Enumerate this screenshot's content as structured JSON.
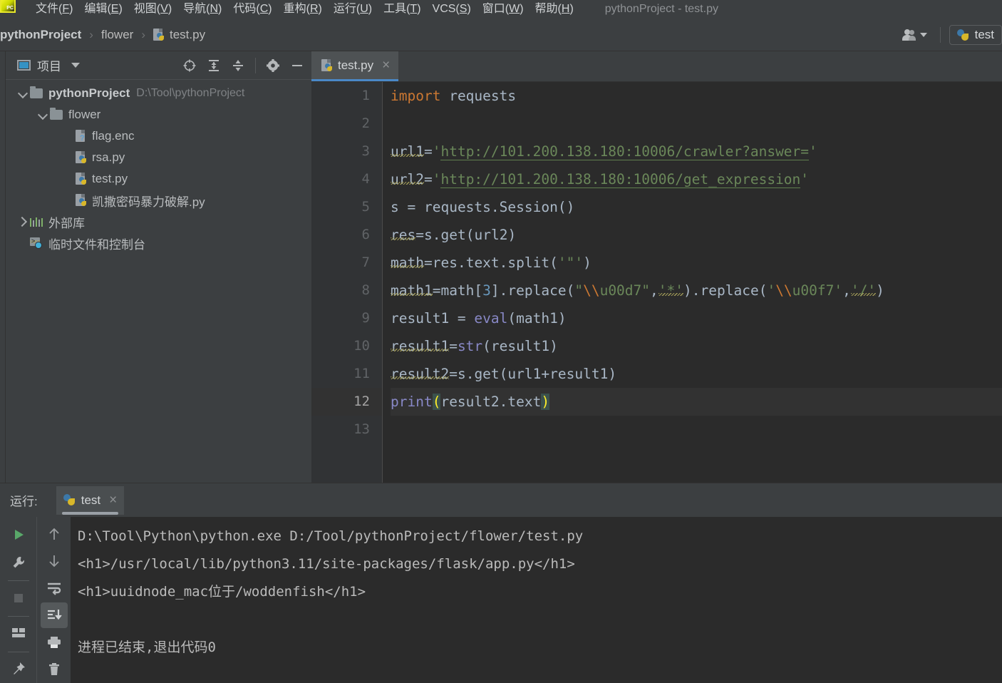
{
  "window": {
    "title": "pythonProject - test.py",
    "logo_text": "PC"
  },
  "menubar": {
    "items": [
      {
        "label": "文件(F)",
        "mnemonic": "F"
      },
      {
        "label": "编辑(E)",
        "mnemonic": "E"
      },
      {
        "label": "视图(V)",
        "mnemonic": "V"
      },
      {
        "label": "导航(N)",
        "mnemonic": "N"
      },
      {
        "label": "代码(C)",
        "mnemonic": "C"
      },
      {
        "label": "重构(R)",
        "mnemonic": "R"
      },
      {
        "label": "运行(U)",
        "mnemonic": "U"
      },
      {
        "label": "工具(T)",
        "mnemonic": "T"
      },
      {
        "label": "VCS(S)",
        "mnemonic": "S"
      },
      {
        "label": "窗口(W)",
        "mnemonic": "W"
      },
      {
        "label": "帮助(H)",
        "mnemonic": "H"
      }
    ]
  },
  "navbar": {
    "crumbs": [
      "pythonProject",
      "flower",
      "test.py"
    ],
    "separator": "›",
    "run_config": "test"
  },
  "project": {
    "title": "项目",
    "toolbar_icons": [
      "locate-icon",
      "expand-all-icon",
      "collapse-all-icon",
      "gear-icon",
      "hide-icon"
    ],
    "tree": [
      {
        "label": "pythonProject",
        "path": "D:\\Tool\\pythonProject",
        "icon": "folder-icon",
        "indent": 0,
        "expanded": true,
        "bold": true
      },
      {
        "label": "flower",
        "path": "",
        "icon": "folder-icon",
        "indent": 1,
        "expanded": true,
        "bold": false
      },
      {
        "label": "flag.enc",
        "path": "",
        "icon": "unknown-file-icon",
        "indent": 2,
        "expanded": null,
        "bold": false
      },
      {
        "label": "rsa.py",
        "path": "",
        "icon": "python-file-icon",
        "indent": 2,
        "expanded": null,
        "bold": false
      },
      {
        "label": "test.py",
        "path": "",
        "icon": "python-file-icon",
        "indent": 2,
        "expanded": null,
        "bold": false
      },
      {
        "label": "凯撒密码暴力破解.py",
        "path": "",
        "icon": "python-file-icon",
        "indent": 2,
        "expanded": null,
        "bold": false
      },
      {
        "label": "外部库",
        "path": "",
        "icon": "library-icon",
        "indent": 0,
        "expanded": false,
        "bold": false
      },
      {
        "label": "临时文件和控制台",
        "path": "",
        "icon": "scratches-icon",
        "indent": 0,
        "expanded": null,
        "bold": false
      }
    ]
  },
  "editor": {
    "tab": {
      "label": "test.py",
      "close": "×"
    },
    "line_numbers": [
      1,
      2,
      3,
      4,
      5,
      6,
      7,
      8,
      9,
      10,
      11,
      12,
      13
    ],
    "current_line": 12,
    "lines": [
      "import requests",
      "",
      "url1='http://101.200.138.180:10006/crawler?answer='",
      "url2='http://101.200.138.180:10006/get_expression'",
      "s = requests.Session()",
      "res=s.get(url2)",
      "math=res.text.split('\"')",
      "math1=math[3].replace(\"\\\\u00d7\",'*').replace('\\\\u00f7','/')",
      "result1 = eval(math1)",
      "result1=str(result1)",
      "result2=s.get(url1+result1)",
      "print(result2.text)",
      ""
    ]
  },
  "run": {
    "label": "运行:",
    "tab": {
      "label": "test",
      "close": "×"
    },
    "toolbar_left": [
      "rerun-icon",
      "settings-icon",
      "stop-icon",
      "layout-icon",
      "pin-icon"
    ],
    "toolbar_right": [
      "up-icon",
      "down-icon",
      "soft-wrap-icon",
      "scroll-to-end-icon",
      "print-icon",
      "trash-icon"
    ],
    "console": [
      "D:\\Tool\\Python\\python.exe D:/Tool/pythonProject/flower/test.py",
      "<h1>/usr/local/lib/python3.11/site-packages/flask/app.py</h1>",
      "<h1>uuidnode_mac位于/woddenfish</h1>",
      "",
      "进程已结束,退出代码0"
    ]
  },
  "colors": {
    "bg_chrome": "#3c3f41",
    "bg_editor": "#2b2b2b",
    "gutter": "#313335",
    "accent_tab": "#4a88c7",
    "keyword": "#cc7832",
    "string": "#6a8759",
    "number": "#6897bb",
    "function": "#8888c6",
    "text": "#a9b7c6",
    "bracket_highlight": "#3b514d",
    "bracket_text": "#ffef28"
  }
}
